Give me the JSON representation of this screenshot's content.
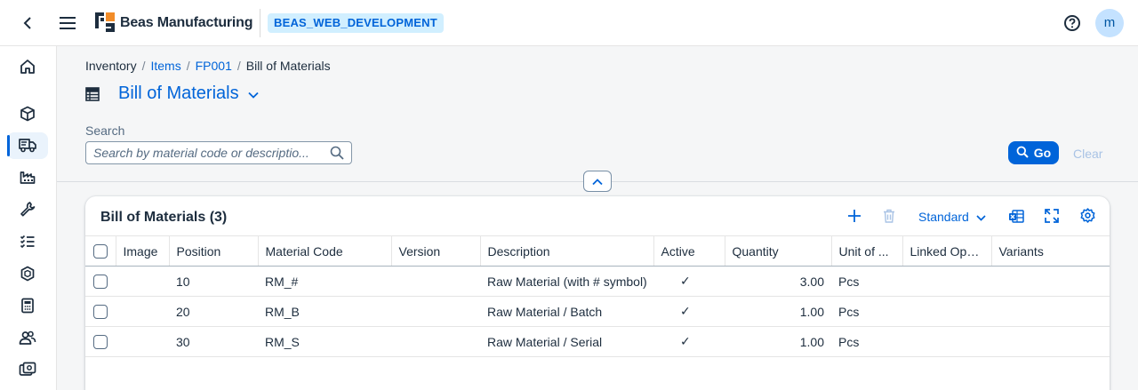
{
  "shell": {
    "brand": "Beas Manufacturing",
    "system": "BEAS_WEB_DEVELOPMENT",
    "avatar_initial": "m"
  },
  "sidenav": {
    "items": [
      {
        "icon": "home-icon"
      },
      {
        "icon": "cube-icon"
      },
      {
        "icon": "truck-icon",
        "active": true
      },
      {
        "icon": "factory-icon"
      },
      {
        "icon": "wrench-icon"
      },
      {
        "icon": "checklist-icon"
      },
      {
        "icon": "package-icon"
      },
      {
        "icon": "calculator-icon"
      },
      {
        "icon": "people-icon"
      },
      {
        "icon": "money-icon"
      }
    ]
  },
  "breadcrumb": {
    "items": [
      "Inventory",
      "Items",
      "FP001"
    ],
    "current": "Bill of Materials",
    "separator": "/"
  },
  "page": {
    "title": "Bill of Materials"
  },
  "filter": {
    "search_label": "Search",
    "search_placeholder": "Search by material code or descriptio...",
    "go_label": "Go",
    "clear_label": "Clear"
  },
  "table": {
    "title": "Bill of Materials (3)",
    "variant": "Standard",
    "columns": [
      "Image",
      "Position",
      "Material Code",
      "Version",
      "Description",
      "Active",
      "Quantity",
      "Unit of ...",
      "Linked Ope...",
      "Variants"
    ],
    "rows": [
      {
        "position": "10",
        "material_code": "RM_#",
        "version": "",
        "description": "Raw Material (with # symbol)",
        "active": "✓",
        "quantity": "3.00",
        "unit": "Pcs",
        "linked": "",
        "variants": ""
      },
      {
        "position": "20",
        "material_code": "RM_B",
        "version": "",
        "description": "Raw Material / Batch",
        "active": "✓",
        "quantity": "1.00",
        "unit": "Pcs",
        "linked": "",
        "variants": ""
      },
      {
        "position": "30",
        "material_code": "RM_S",
        "version": "",
        "description": "Raw Material / Serial",
        "active": "✓",
        "quantity": "1.00",
        "unit": "Pcs",
        "linked": "",
        "variants": ""
      }
    ]
  },
  "colors": {
    "accent": "#0064d9",
    "text": "#1d2d3e",
    "system_badge_bg": "#d1efff"
  }
}
